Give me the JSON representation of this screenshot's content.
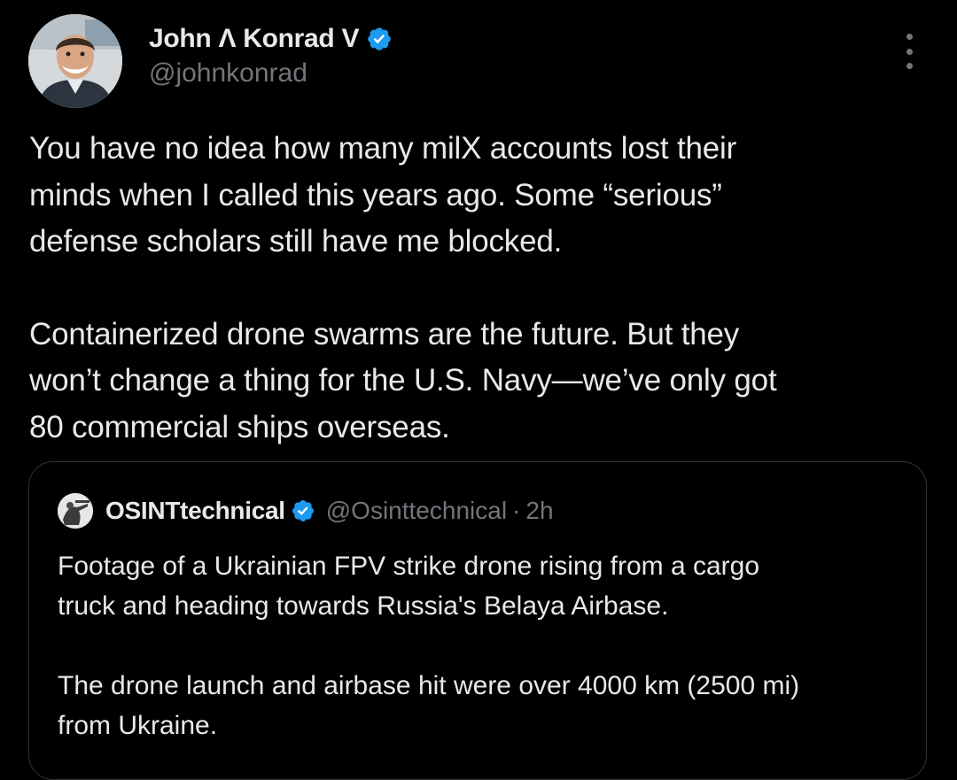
{
  "author": {
    "name": "John Λ Konrad V",
    "handle": "@johnkonrad",
    "verified_color": "#1d9bf0"
  },
  "tweet": {
    "paragraphs": [
      "You have no idea how many milX accounts lost their\nminds when I called this years ago. Some “serious”\ndefense scholars still have me blocked.",
      "Containerized drone swarms are the future. But they\nwon’t change a thing for the U.S. Navy—we’ve only got\n80 commercial ships overseas."
    ]
  },
  "quote": {
    "name": "OSINTtechnical",
    "handle": "@Osinttechnical",
    "separator": "·",
    "time": "2h",
    "paragraphs": [
      "Footage of a Ukrainian FPV strike drone rising from a cargo\ntruck and heading towards Russia's Belaya Airbase.",
      "The drone launch and airbase hit were over 4000 km (2500 mi)\nfrom Ukraine."
    ]
  },
  "colors": {
    "background": "#000000",
    "text": "#e7e9ea",
    "secondary_text": "#71767b",
    "border": "#2f3336",
    "verified": "#1d9bf0"
  },
  "icons": {
    "verified": "verified-badge-icon",
    "more": "more-options-icon"
  }
}
